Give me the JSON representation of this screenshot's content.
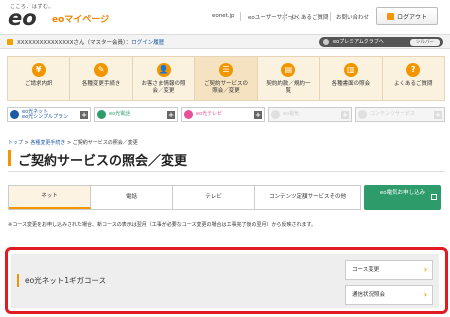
{
  "header": {
    "tagline": "こころ、はずむ。",
    "logo": "eo",
    "brand": "eoマイページ",
    "nav": [
      "eonet.jp",
      "eoユーザーサポート",
      "よくあるご質問",
      "お問い合わせ"
    ],
    "logout_label": "ログアウト"
  },
  "userbar": {
    "user_masked": "XXXXXXXXXXXXXXX",
    "suffix": "さん（マスター会員）：",
    "login_history": "ログイン履歴",
    "premium_label": "eoプレミアムクラブへ",
    "rank": "シルバー"
  },
  "menu": [
    {
      "label": "ご請求内訳",
      "icon": "¥"
    },
    {
      "label": "各種変更手続き",
      "icon": "✎"
    },
    {
      "label": "お客さま情報の照会／変更",
      "icon": "👤"
    },
    {
      "label": "ご契約サービスの照会／変更",
      "icon": "☰"
    },
    {
      "label": "契約約款／規約一覧",
      "icon": "▤"
    },
    {
      "label": "各種書面の照会",
      "icon": "▥"
    },
    {
      "label": "よくあるご質問",
      "icon": "?"
    }
  ],
  "services": [
    {
      "label1": "eo光ネット",
      "label2": "eo光シンプルプラン",
      "color": "#1a5aa6"
    },
    {
      "label1": "eo光電話",
      "label2": "",
      "color": "#2e9b6b"
    },
    {
      "label1": "eo光テレビ",
      "label2": "",
      "color": "#e8509a"
    },
    {
      "label1": "eo電気",
      "label2": "",
      "color": "#cccccc"
    },
    {
      "label1": "コンテンツサービス",
      "label2": "",
      "color": "#cccccc"
    }
  ],
  "breadcrumb": {
    "home": "トップ",
    "step1": "各種変更手続き",
    "current": "ご契約サービスの照会／変更"
  },
  "page_title": "ご契約サービスの照会／変更",
  "tabs": [
    "ネット",
    "電話",
    "テレビ",
    "コンテンツ定額サービスその他"
  ],
  "apply_button": "eo電気お申し込み",
  "note": "※コース変更をお申し込みされた場合、新コースの表示は翌月（工事が必要なコース変更の場合は工事完了後の翌月）から反映されます。",
  "course": {
    "name": "eo光ネット1ギガコース",
    "btn_change": "コース変更",
    "btn_speed": "通信状況照会"
  },
  "colors": {
    "accent": "#f29600",
    "highlight": "#e01b24",
    "apply": "#2e9b6b"
  }
}
